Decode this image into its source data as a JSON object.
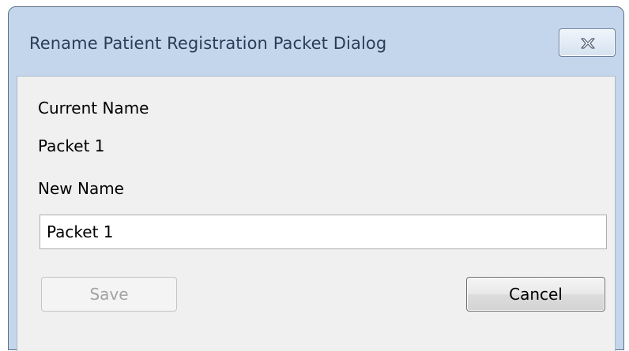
{
  "window": {
    "title": "Rename Patient Registration Packet Dialog",
    "close_icon": "close-x-icon"
  },
  "form": {
    "current_name_label": "Current Name",
    "current_name_value": "Packet 1",
    "new_name_label": "New Name",
    "new_name_value": "Packet 1"
  },
  "buttons": {
    "save_label": "Save",
    "save_enabled": false,
    "cancel_label": "Cancel"
  },
  "colors": {
    "frame": "#c3d6ec",
    "client_background": "#f0f0f0",
    "title_text": "#2b3d55",
    "disabled_text": "#a3a3a3"
  }
}
